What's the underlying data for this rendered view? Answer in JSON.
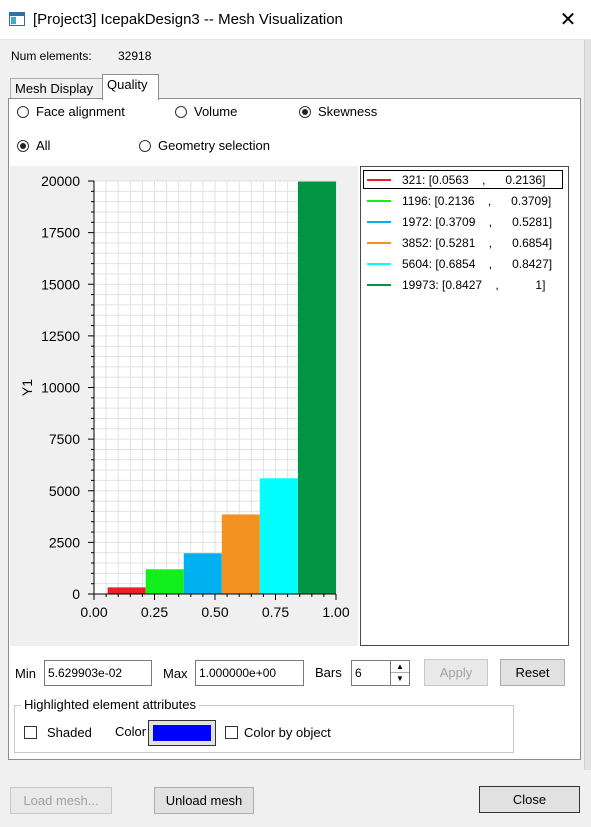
{
  "window": {
    "title": "[Project3] IcepakDesign3 -- Mesh Visualization",
    "close_glyph": "✕"
  },
  "summary": {
    "num_elements_label": "Num elements:",
    "num_elements_value": "32918"
  },
  "tabs": [
    {
      "label": "Mesh Display",
      "active": false
    },
    {
      "label": "Quality",
      "active": true
    }
  ],
  "metric_options": [
    {
      "label": "Face alignment",
      "selected": false
    },
    {
      "label": "Volume",
      "selected": false
    },
    {
      "label": "Skewness",
      "selected": true
    }
  ],
  "scope_options": [
    {
      "label": "All",
      "selected": true
    },
    {
      "label": "Geometry selection",
      "selected": false
    }
  ],
  "chart_data": {
    "type": "bar",
    "title": "",
    "xlabel": "",
    "ylabel": "Y1",
    "xlim": [
      0.0,
      1.0
    ],
    "ylim": [
      0,
      20000
    ],
    "grid": true,
    "x_ticks": [
      "0.00",
      "0.25",
      "0.50",
      "0.75",
      "1.00"
    ],
    "y_ticks": [
      "0",
      "2500",
      "5000",
      "7500",
      "10000",
      "12500",
      "15000",
      "17500",
      "20000"
    ],
    "bins": [
      {
        "x0": 0.0563,
        "x1": 0.2136,
        "count": 321,
        "color": "#e8202a"
      },
      {
        "x0": 0.2136,
        "x1": 0.3709,
        "count": 1196,
        "color": "#11f01a"
      },
      {
        "x0": 0.3709,
        "x1": 0.5281,
        "count": 1972,
        "color": "#00b0f0"
      },
      {
        "x0": 0.5281,
        "x1": 0.6854,
        "count": 3852,
        "color": "#f29321"
      },
      {
        "x0": 0.6854,
        "x1": 0.8427,
        "count": 5604,
        "color": "#00ffff"
      },
      {
        "x0": 0.8427,
        "x1": 1.0,
        "count": 19973,
        "color": "#009444"
      }
    ],
    "legend": [
      {
        "label": "321: [0.0563    ,      0.2136]",
        "color": "#e8202a"
      },
      {
        "label": "1196: [0.2136    ,      0.3709]",
        "color": "#11f01a"
      },
      {
        "label": "1972: [0.3709    ,      0.5281]",
        "color": "#00b0f0"
      },
      {
        "label": "3852: [0.5281    ,      0.6854]",
        "color": "#f29321"
      },
      {
        "label": "5604: [0.6854    ,      0.8427]",
        "color": "#00ffff"
      },
      {
        "label": "19973: [0.8427    ,           1]",
        "color": "#009444"
      }
    ]
  },
  "range": {
    "min_label": "Min",
    "min_value": "5.629903e-02",
    "max_label": "Max",
    "max_value": "1.000000e+00",
    "bars_label": "Bars",
    "bars_value": "6",
    "apply_label": "Apply",
    "reset_label": "Reset"
  },
  "highlight": {
    "group_title": "Highlighted element attributes",
    "shaded_label": "Shaded",
    "color_label": "Color",
    "color_value": "#0000ff",
    "color_by_object_label": "Color by object"
  },
  "footer": {
    "load_mesh_label": "Load mesh...",
    "unload_mesh_label": "Unload mesh",
    "close_label": "Close"
  }
}
